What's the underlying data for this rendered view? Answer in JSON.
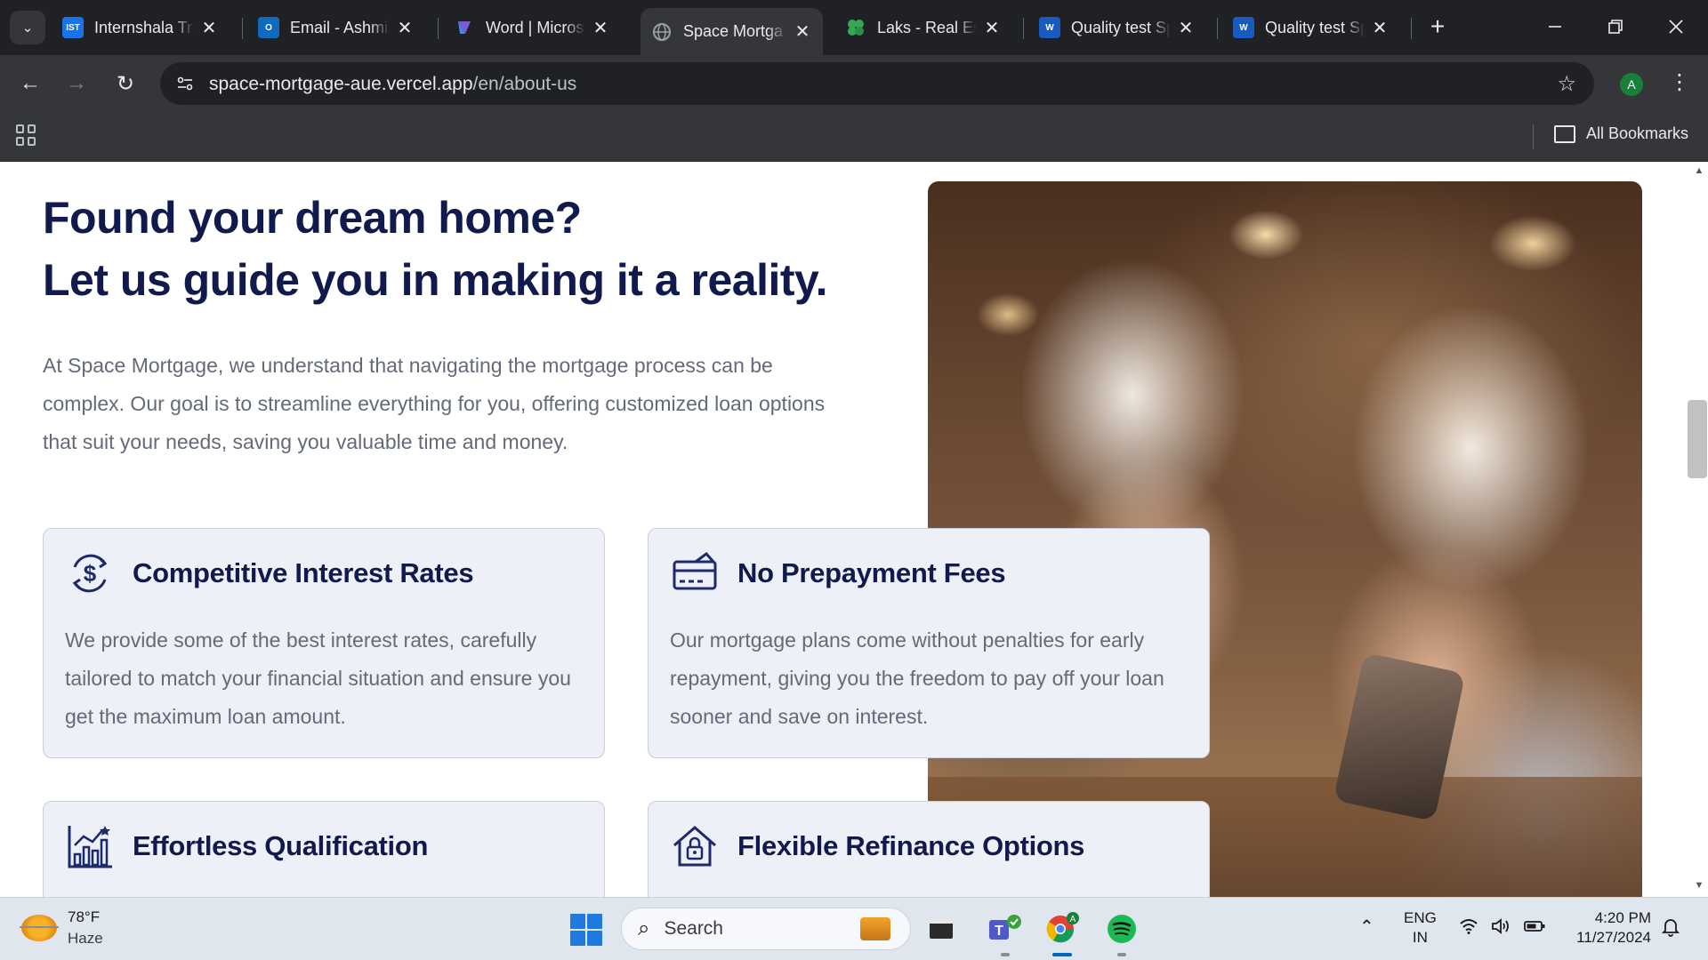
{
  "browser": {
    "tabs": [
      {
        "favicon": "IST",
        "favicon_color": "#1a73e8",
        "title": "Internshala Tra",
        "active": false
      },
      {
        "favicon": "O",
        "favicon_color": "#0f6cbd",
        "title": "Email - Ashmit",
        "active": false
      },
      {
        "favicon": "copilot-icon",
        "favicon_color": "#7b5cd6",
        "title": "Word | Micros",
        "active": false
      },
      {
        "favicon": "globe-icon",
        "favicon_color": "#5f6368",
        "title": "Space Mortga",
        "active": true
      },
      {
        "favicon": "clover-icon",
        "favicon_color": "#34a853",
        "title": "Laks - Real Est",
        "active": false
      },
      {
        "favicon": "W",
        "favicon_color": "#185abd",
        "title": "Quality test Sp",
        "active": false
      },
      {
        "favicon": "W",
        "favicon_color": "#185abd",
        "title": "Quality test Sp",
        "active": false
      }
    ],
    "close_glyph": "✕",
    "new_tab_glyph": "+",
    "url_domain": "space-mortgage-aue.vercel.app",
    "url_path": "/en/about-us",
    "profile_initial": "A",
    "all_bookmarks": "All Bookmarks"
  },
  "page": {
    "heading_line1": "Found your dream home?",
    "heading_line2": "Let us guide you in making it a reality.",
    "intro": "At Space Mortgage, we understand that navigating the mortgage process can be complex. Our goal is to streamline everything for you, offering customized loan options that suit your needs, saving you valuable time and money.",
    "features": [
      {
        "icon": "dollar-cycle-icon",
        "title": "Competitive Interest Rates",
        "text": "We provide some of the best interest rates, carefully tailored to match your financial situation and ensure you get the maximum loan amount."
      },
      {
        "icon": "card-icon",
        "title": "No Prepayment Fees",
        "text": "Our mortgage plans come without penalties for early repayment, giving you the freedom to pay off your loan sooner and save on interest."
      },
      {
        "icon": "growth-chart-icon",
        "title": "Effortless Qualification",
        "text": ""
      },
      {
        "icon": "home-lock-icon",
        "title": "Flexible Refinance Options",
        "text": ""
      }
    ],
    "colors": {
      "heading": "#101a4d",
      "body_text": "#636a78",
      "card_bg": "#eef0f8",
      "card_border": "#c9cee0"
    }
  },
  "taskbar": {
    "weather_temp": "78°F",
    "weather_desc": "Haze",
    "search_label": "Search",
    "lang_top": "ENG",
    "lang_bottom": "IN",
    "time": "4:20 PM",
    "date": "11/27/2024",
    "apps": [
      "files-icon",
      "teams-icon",
      "chrome-icon",
      "spotify-icon"
    ]
  }
}
